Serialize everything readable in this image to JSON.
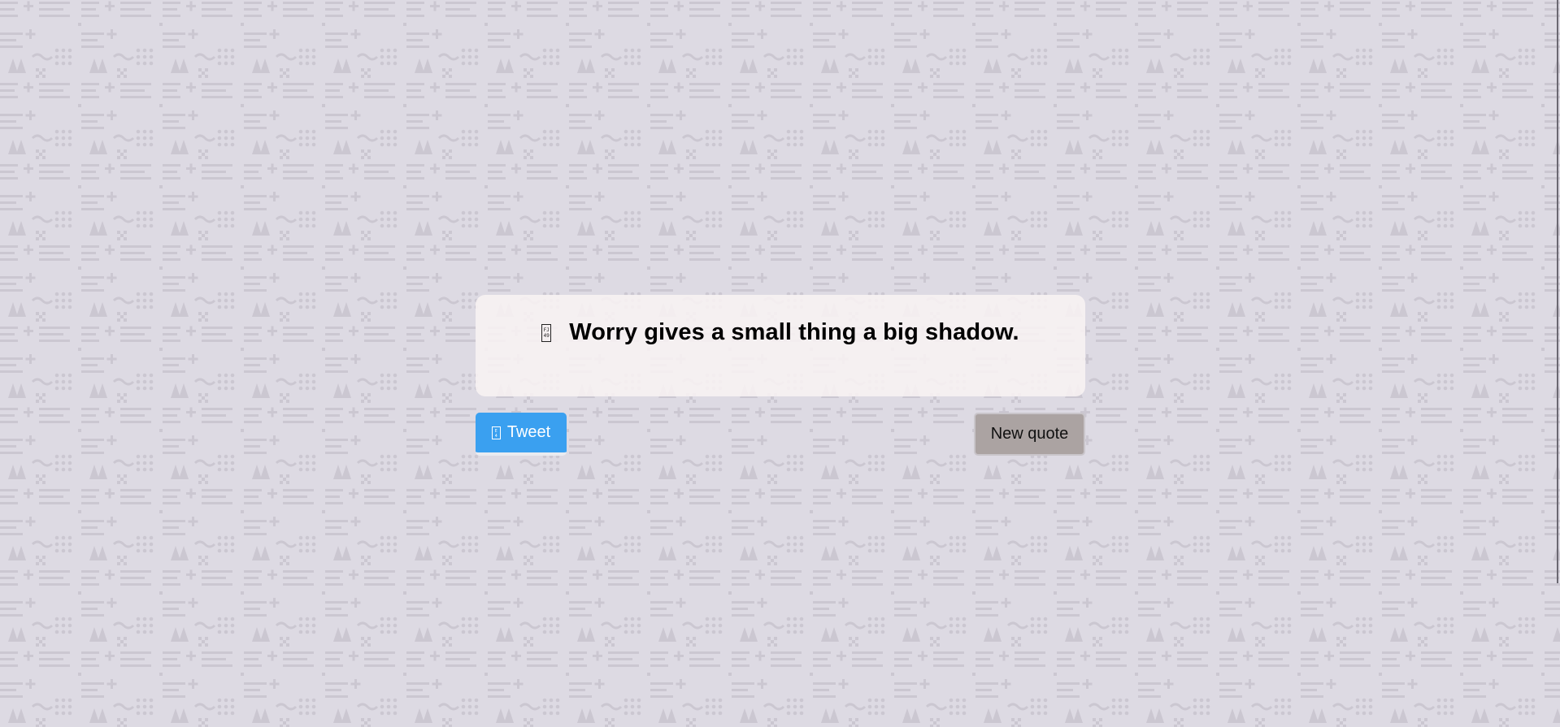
{
  "quote": {
    "text": "Worry gives a small thing a big shadow.",
    "icon": "quote-left-icon",
    "icon_glyph": "FJ 49"
  },
  "buttons": {
    "tweet_label": "Tweet",
    "tweet_icon": "twitter-icon",
    "tweet_icon_glyph": "E 4",
    "new_quote_label": "New quote"
  },
  "colors": {
    "background": "#dddae3",
    "pattern": "#cbc7d1",
    "tweet_button": "#3aa0f0",
    "new_quote_button": "#aba3a2"
  }
}
